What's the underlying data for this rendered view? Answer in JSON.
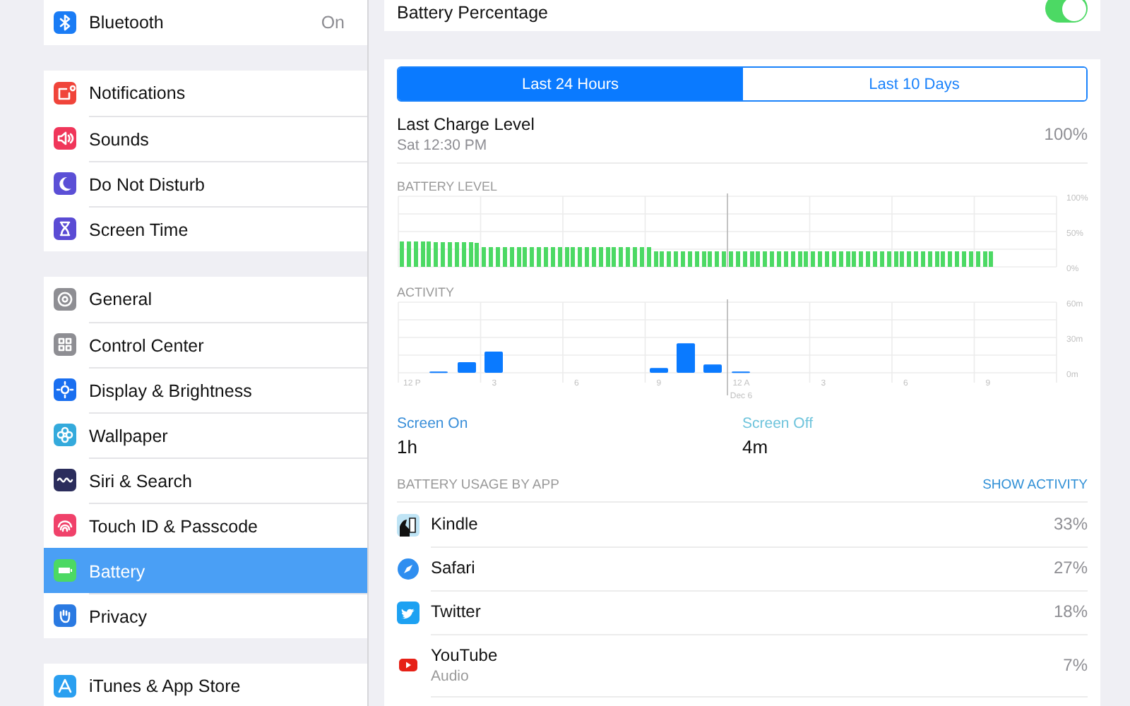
{
  "sidebar": {
    "groups": [
      [
        {
          "label": "Bluetooth",
          "value": "On",
          "color": "#1a7cf5",
          "selected": false
        }
      ],
      [
        {
          "label": "Notifications",
          "color": "#f0443a",
          "selected": false
        },
        {
          "label": "Sounds",
          "color": "#f0365a",
          "selected": false
        },
        {
          "label": "Do Not Disturb",
          "color": "#5b4fd6",
          "selected": false
        },
        {
          "label": "Screen Time",
          "color": "#5a4bd4",
          "selected": false
        }
      ],
      [
        {
          "label": "General",
          "color": "#8e8e93",
          "selected": false
        },
        {
          "label": "Control Center",
          "color": "#8e8e93",
          "selected": false
        },
        {
          "label": "Display & Brightness",
          "color": "#1a6ff0",
          "selected": false
        },
        {
          "label": "Wallpaper",
          "color": "#34aadc",
          "selected": false
        },
        {
          "label": "Siri & Search",
          "color": "#2b2d5c",
          "selected": false
        },
        {
          "label": "Touch ID & Passcode",
          "color": "#f0416a",
          "selected": false
        },
        {
          "label": "Battery",
          "color": "#4cd964",
          "selected": true
        },
        {
          "label": "Privacy",
          "color": "#2a7ae2",
          "selected": false
        }
      ],
      [
        {
          "label": "iTunes & App Store",
          "color": "#2a9ff0",
          "selected": false
        }
      ]
    ]
  },
  "battery_percentage": {
    "label": "Battery Percentage",
    "on": true
  },
  "tabs": [
    {
      "label": "Last 24 Hours",
      "selected": true
    },
    {
      "label": "Last 10 Days",
      "selected": false
    }
  ],
  "last_charge": {
    "title": "Last Charge Level",
    "time": "Sat 12:30 PM",
    "value": "100%"
  },
  "battery_level": {
    "chart_data": {
      "type": "bar",
      "title": "BATTERY LEVEL",
      "grid": true,
      "ylim": [
        0,
        100
      ],
      "categories": [
        null,
        null,
        null,
        null,
        null,
        null,
        null,
        null,
        null,
        null,
        null,
        null,
        null,
        null,
        null,
        null,
        null,
        null,
        null,
        null,
        null,
        null,
        null,
        null,
        null,
        null,
        null,
        null,
        null,
        null,
        null,
        null,
        null,
        null,
        null,
        null,
        null,
        null,
        null,
        null,
        null,
        null,
        null,
        null,
        null,
        null,
        null,
        null,
        null,
        null,
        null,
        null,
        null,
        null,
        null,
        null,
        null,
        null,
        null,
        null,
        null,
        null,
        null,
        null,
        null,
        null,
        null,
        null,
        null,
        null,
        null,
        null,
        null,
        null,
        null,
        null,
        null,
        null,
        null,
        null,
        null,
        null,
        null,
        null,
        null,
        null,
        null,
        null,
        null,
        null,
        null,
        null,
        null,
        null,
        null,
        null
      ],
      "yticks": [
        {
          "value": 0,
          "label": "0%"
        },
        {
          "value": 50,
          "label": "50%"
        },
        {
          "value": 100,
          "label": "100%"
        }
      ],
      "series": [
        {
          "color": "#4cd964",
          "values": [
            36,
            36,
            36,
            36,
            36,
            35,
            35,
            35,
            35,
            35,
            35,
            34,
            28,
            28,
            28,
            28,
            28,
            28,
            28,
            28,
            28,
            28,
            28,
            28,
            28,
            28,
            28,
            28,
            28,
            28,
            28,
            28,
            28,
            28,
            28,
            28,
            28,
            22,
            22,
            22,
            22,
            22,
            22,
            22,
            22,
            22,
            22,
            22,
            22,
            22,
            22,
            22,
            22,
            22,
            22,
            22,
            22,
            22,
            22,
            22,
            22,
            22,
            22,
            22,
            22,
            22,
            22,
            22,
            22,
            22,
            22,
            22,
            22,
            22,
            22,
            22,
            22,
            22,
            22,
            22,
            22,
            22,
            22,
            22,
            22,
            22,
            22,
            null,
            null,
            null,
            null,
            null,
            null,
            null,
            null,
            null
          ]
        }
      ]
    }
  },
  "activity": {
    "chart_data": {
      "type": "bar",
      "title": "ACTIVITY",
      "grid": true,
      "ylim": [
        0,
        60
      ],
      "categories": [
        "12 P",
        null,
        null,
        "3",
        null,
        null,
        "6",
        null,
        null,
        "9",
        null,
        null,
        "12 A",
        null,
        null,
        "3",
        null,
        null,
        "6",
        null,
        null,
        "9",
        null,
        null
      ],
      "yticks": [
        {
          "value": 0,
          "label": "0m"
        },
        {
          "value": 30,
          "label": "30m"
        },
        {
          "value": 60,
          "label": "60m"
        }
      ],
      "annotations": [
        "Dec 6"
      ],
      "series": [
        {
          "color": "#0a7aff",
          "values": [
            0,
            1,
            9,
            18,
            0,
            0,
            0,
            0,
            0,
            4,
            25,
            7,
            1,
            null,
            null,
            null,
            null,
            null,
            null,
            null,
            null,
            null,
            null,
            null
          ]
        }
      ]
    }
  },
  "screen_times": [
    {
      "label": "Screen On",
      "value": "1h",
      "color": "#3a8fd9"
    },
    {
      "label": "Screen Off",
      "value": "4m",
      "color": "#6fc4dc"
    }
  ],
  "usage": {
    "title": "BATTERY USAGE BY APP",
    "action": "SHOW ACTIVITY",
    "apps": [
      {
        "name": "Kindle",
        "percent": "33%"
      },
      {
        "name": "Safari",
        "percent": "27%"
      },
      {
        "name": "Twitter",
        "percent": "18%"
      },
      {
        "name": "YouTube",
        "detail": "Audio",
        "percent": "7%"
      }
    ]
  }
}
